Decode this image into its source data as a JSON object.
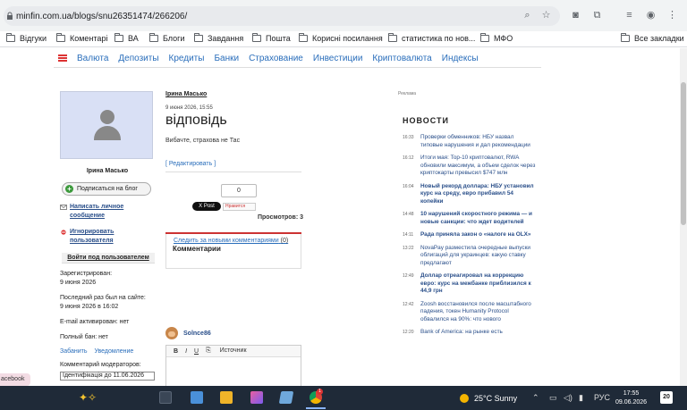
{
  "browser": {
    "url": "minfin.com.ua/blogs/snu26351474/266206/",
    "bookmarks": [
      "Відгуки",
      "Коментарі",
      "ВА",
      "Блоги",
      "Завдання",
      "Пошта",
      "Корисні посилання",
      "статистика по нов...",
      "МФО"
    ],
    "all_bookmarks": "Все закладки"
  },
  "nav": {
    "items": [
      "Валюта",
      "Депозиты",
      "Кредиты",
      "Банки",
      "Страхование",
      "Инвестиции",
      "Криптовалюта",
      "Индексы"
    ]
  },
  "author": {
    "name": "Ірина Масько",
    "subscribe": "Подписаться на блог",
    "write_message": "Написать личное сообщение",
    "ignore_user": "Игнорировать пользователя",
    "login_button": "Войти под пользователем",
    "registered_label": "Зарегистрирован:",
    "registered_date": "9 июня 2026",
    "last_seen_label": "Последний раз был на сайте:",
    "last_seen_date": "9 июня 2026 в 16:02",
    "email_status": "E-mail активирован: нет",
    "full_ban": "Полный бан: нет",
    "ban_link": "Забанить",
    "notifications_link": "Уведомление",
    "moderator_comment_label": "Комментарий модераторов:",
    "moderator_comment_value": "Ідентифікація до 11.06.2026"
  },
  "post": {
    "author": "Ірина Масько",
    "date": "9 июня 2026, 15:55",
    "title": "відповідь",
    "body": "Вибачте, страхова не Тас",
    "edit": "[ Редактировать ]",
    "counter": "0",
    "x_post": "X Post",
    "like": "Нравится",
    "views": "Просмотров: 3",
    "follow": "Следить за новыми комментариями",
    "follow_count": "(0)",
    "comments_title": "Комментарии",
    "commenter": "Solnce86",
    "editor_bold": "B",
    "editor_italic": "I",
    "editor_underline": "U",
    "editor_source": "Источник"
  },
  "ads": {
    "label": "Реклама"
  },
  "news": {
    "title": "НОВОСТИ",
    "items": [
      {
        "time": "16:33",
        "text": "Проверки обменников: НБУ назвал типовые нарушения и дал рекомендации",
        "bold": false
      },
      {
        "time": "16:12",
        "text": "Итоги мая: Top-10 криптовалют, RWA обновили максимум, а объем сделок через криптокарты превысил $747 млн",
        "bold": false
      },
      {
        "time": "16:04",
        "text": "Новый рекорд доллара: НБУ установил курс на среду, евро прибавил 54 копейки",
        "bold": true
      },
      {
        "time": "14:48",
        "text": "10 нарушений скоростного режима — и новые санкции: что ждет водителей",
        "bold": true
      },
      {
        "time": "14:11",
        "text": "Рада приняла закон о «налоге на OLX»",
        "bold": true
      },
      {
        "time": "13:22",
        "text": "NovaPay разместила очередные выпуски облигаций для украинцев: какую ставку предлагают",
        "bold": false
      },
      {
        "time": "12:49",
        "text": "Доллар отреагировал на коррекцию евро: курс на межбанке приблизился к 44,9 грн",
        "bold": true
      },
      {
        "time": "12:42",
        "text": "Zoosh восстановился после масштабного падения, токен Humanity Protocol обвалился на 90%: что нового",
        "bold": false
      },
      {
        "time": "12:20",
        "text": "Bank of America: на рынке есть",
        "bold": false
      }
    ]
  },
  "side_tab": "acebook",
  "taskbar": {
    "weather": "25°C  Sunny",
    "lang": "РУС",
    "time": "17:55",
    "date": "09.06.2026",
    "notifications": "20",
    "chrome_badge": "1"
  }
}
